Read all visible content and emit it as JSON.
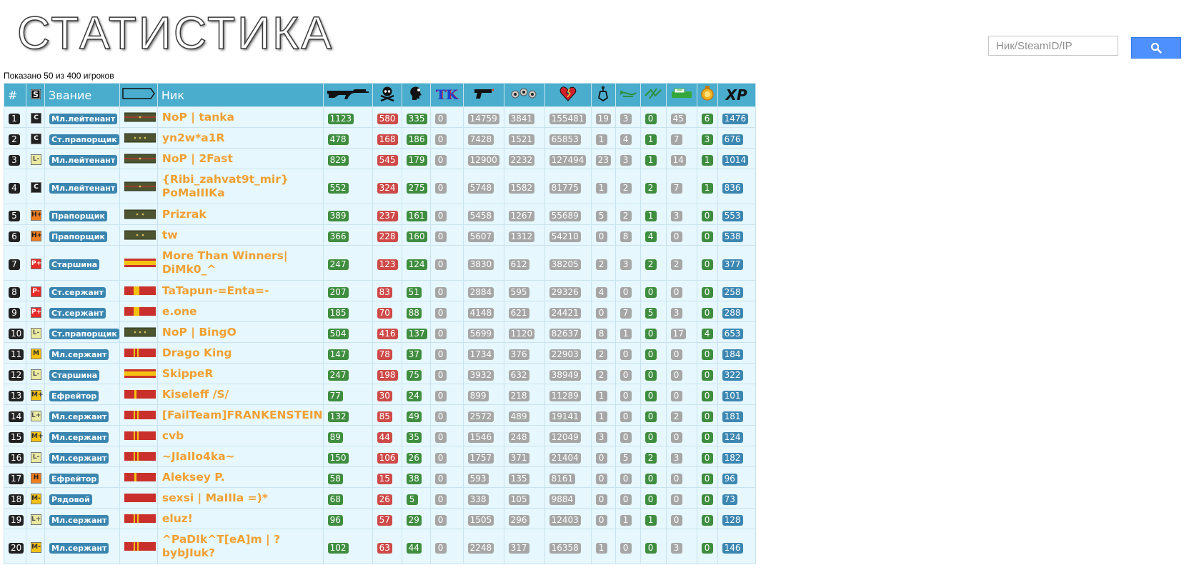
{
  "page": {
    "title": "СТАТИСТИКА",
    "shown_info": "Показано 50 из 400 игроков"
  },
  "search": {
    "placeholder": "Ник/SteamID/IP",
    "value": "",
    "button_icon": "search-icon"
  },
  "table": {
    "headers": {
      "num": "#",
      "skill_icon": "skill-s-icon",
      "rank": "Звание",
      "shoulder_icon": "shoulder-strap-icon",
      "nick": "Ник",
      "kills_icon": "rifle-icon",
      "deaths_icon": "skull-crossbones-icon",
      "headshots_icon": "headshot-icon",
      "teamkills": "TK",
      "shots_icon": "pistol-icon",
      "hits_icon": "bullet-holes-icon",
      "damage_icon": "broken-heart-icon",
      "suicides_icon": "grenade-icon",
      "bomb_plants_icon": "bomb-plant-icon",
      "bomb_defuses_icon": "bomb-defuse-icon",
      "bomb_explosions_icon": "bomb-explode-icon",
      "wins_icon": "medal-icon",
      "xp": "XP"
    },
    "rows": [
      {
        "num": "1",
        "skill": "C",
        "skill_bg": "#222222",
        "skill_fg": "#ffffff",
        "rank": "Мл.лейтенант",
        "strap": "lt",
        "nick": "NoP | tanka",
        "kills": "1123",
        "deaths": "580",
        "hs": "335",
        "tk": "0",
        "shots": "14759",
        "hits": "3841",
        "dmg": "155481",
        "c1": "19",
        "c2": "3",
        "c3": "0",
        "c4": "45",
        "c5": "6",
        "xp": "1476",
        "tall": false
      },
      {
        "num": "2",
        "skill": "C",
        "skill_bg": "#222222",
        "skill_fg": "#ffffff",
        "rank": "Ст.прапорщик",
        "strap": "praporshik3",
        "nick": "yn2w*a1R",
        "kills": "478",
        "deaths": "168",
        "hs": "186",
        "tk": "0",
        "shots": "7428",
        "hits": "1521",
        "dmg": "65853",
        "c1": "1",
        "c2": "4",
        "c3": "1",
        "c4": "7",
        "c5": "3",
        "xp": "676",
        "tall": false
      },
      {
        "num": "3",
        "skill": "L-",
        "skill_bg": "#eaeaa0",
        "skill_fg": "#555555",
        "rank": "Мл.лейтенант",
        "strap": "lt",
        "nick": "NoP | 2Fast",
        "kills": "829",
        "deaths": "545",
        "hs": "179",
        "tk": "0",
        "shots": "12900",
        "hits": "2232",
        "dmg": "127494",
        "c1": "23",
        "c2": "3",
        "c3": "1",
        "c4": "14",
        "c5": "1",
        "xp": "1014",
        "tall": false
      },
      {
        "num": "4",
        "skill": "C",
        "skill_bg": "#222222",
        "skill_fg": "#ffffff",
        "rank": "Мл.лейтенант",
        "strap": "lt",
        "nick": "{Ribi_zahvat9t_mir} PoMaIIIKa",
        "kills": "552",
        "deaths": "324",
        "hs": "275",
        "tk": "0",
        "shots": "5748",
        "hits": "1582",
        "dmg": "81775",
        "c1": "1",
        "c2": "2",
        "c3": "2",
        "c4": "7",
        "c5": "1",
        "xp": "836",
        "tall": true
      },
      {
        "num": "5",
        "skill": "H+",
        "skill_bg": "#f07d1e",
        "skill_fg": "#222222",
        "rank": "Прапорщик",
        "strap": "praporshik2",
        "nick": "Prizrak",
        "kills": "389",
        "deaths": "237",
        "hs": "161",
        "tk": "0",
        "shots": "5458",
        "hits": "1267",
        "dmg": "55689",
        "c1": "5",
        "c2": "2",
        "c3": "1",
        "c4": "3",
        "c5": "0",
        "xp": "553",
        "tall": false
      },
      {
        "num": "6",
        "skill": "H+",
        "skill_bg": "#f07d1e",
        "skill_fg": "#222222",
        "rank": "Прапорщик",
        "strap": "praporshik2",
        "nick": "tw",
        "kills": "366",
        "deaths": "228",
        "hs": "160",
        "tk": "0",
        "shots": "5607",
        "hits": "1312",
        "dmg": "54210",
        "c1": "0",
        "c2": "8",
        "c3": "4",
        "c4": "0",
        "c5": "0",
        "xp": "538",
        "tall": false
      },
      {
        "num": "7",
        "skill": "P+",
        "skill_bg": "#e82a28",
        "skill_fg": "#ffffff",
        "rank": "Старшина",
        "strap": "starshina",
        "nick": "More Than Winners| DiMk0_^",
        "kills": "247",
        "deaths": "123",
        "hs": "124",
        "tk": "0",
        "shots": "3830",
        "hits": "612",
        "dmg": "38205",
        "c1": "2",
        "c2": "3",
        "c3": "2",
        "c4": "2",
        "c5": "0",
        "xp": "377",
        "tall": true
      },
      {
        "num": "8",
        "skill": "P-",
        "skill_bg": "#e82a28",
        "skill_fg": "#ffffff",
        "rank": "Ст.сержант",
        "strap": "st_serzhant",
        "nick": "TaTapun-=Enta=-",
        "kills": "207",
        "deaths": "83",
        "hs": "51",
        "tk": "0",
        "shots": "2884",
        "hits": "595",
        "dmg": "29326",
        "c1": "4",
        "c2": "0",
        "c3": "0",
        "c4": "0",
        "c5": "0",
        "xp": "258",
        "tall": false
      },
      {
        "num": "9",
        "skill": "P+",
        "skill_bg": "#e82a28",
        "skill_fg": "#ffffff",
        "rank": "Ст.сержант",
        "strap": "st_serzhant",
        "nick": "e.one",
        "kills": "185",
        "deaths": "70",
        "hs": "88",
        "tk": "0",
        "shots": "4148",
        "hits": "621",
        "dmg": "24421",
        "c1": "0",
        "c2": "7",
        "c3": "5",
        "c4": "3",
        "c5": "0",
        "xp": "288",
        "tall": false
      },
      {
        "num": "10",
        "skill": "L-",
        "skill_bg": "#eaeaa0",
        "skill_fg": "#555555",
        "rank": "Ст.прапорщик",
        "strap": "praporshik3",
        "nick": "NoP | BingO",
        "kills": "504",
        "deaths": "416",
        "hs": "137",
        "tk": "0",
        "shots": "5699",
        "hits": "1120",
        "dmg": "82637",
        "c1": "8",
        "c2": "1",
        "c3": "0",
        "c4": "17",
        "c5": "4",
        "xp": "653",
        "tall": false
      },
      {
        "num": "11",
        "skill": "M",
        "skill_bg": "#f5c211",
        "skill_fg": "#333333",
        "rank": "Мл.сержант",
        "strap": "ml_serzhant",
        "nick": "Drago King",
        "kills": "147",
        "deaths": "78",
        "hs": "37",
        "tk": "0",
        "shots": "1734",
        "hits": "376",
        "dmg": "22903",
        "c1": "2",
        "c2": "0",
        "c3": "0",
        "c4": "0",
        "c5": "0",
        "xp": "184",
        "tall": false
      },
      {
        "num": "12",
        "skill": "L-",
        "skill_bg": "#eaeaa0",
        "skill_fg": "#555555",
        "rank": "Старшина",
        "strap": "starshina",
        "nick": "SkippeR",
        "kills": "247",
        "deaths": "198",
        "hs": "75",
        "tk": "0",
        "shots": "3932",
        "hits": "632",
        "dmg": "38949",
        "c1": "2",
        "c2": "0",
        "c3": "0",
        "c4": "0",
        "c5": "0",
        "xp": "322",
        "tall": false
      },
      {
        "num": "13",
        "skill": "M+",
        "skill_bg": "#f5c211",
        "skill_fg": "#333333",
        "rank": "Ефрейтор",
        "strap": "efreitor",
        "nick": "Kiseleff /S/",
        "kills": "77",
        "deaths": "30",
        "hs": "24",
        "tk": "0",
        "shots": "899",
        "hits": "218",
        "dmg": "11289",
        "c1": "1",
        "c2": "0",
        "c3": "0",
        "c4": "0",
        "c5": "0",
        "xp": "101",
        "tall": false
      },
      {
        "num": "14",
        "skill": "L+",
        "skill_bg": "#eaeaa0",
        "skill_fg": "#555555",
        "rank": "Мл.сержант",
        "strap": "ml_serzhant",
        "nick": "[FailTeam]FRANKENSTEIN",
        "kills": "132",
        "deaths": "85",
        "hs": "49",
        "tk": "0",
        "shots": "2572",
        "hits": "489",
        "dmg": "19141",
        "c1": "1",
        "c2": "0",
        "c3": "0",
        "c4": "2",
        "c5": "0",
        "xp": "181",
        "tall": false
      },
      {
        "num": "15",
        "skill": "M+",
        "skill_bg": "#f5c211",
        "skill_fg": "#333333",
        "rank": "Мл.сержант",
        "strap": "ml_serzhant",
        "nick": "cvb",
        "kills": "89",
        "deaths": "44",
        "hs": "35",
        "tk": "0",
        "shots": "1546",
        "hits": "248",
        "dmg": "12049",
        "c1": "3",
        "c2": "0",
        "c3": "0",
        "c4": "0",
        "c5": "0",
        "xp": "124",
        "tall": false
      },
      {
        "num": "16",
        "skill": "L-",
        "skill_bg": "#eaeaa0",
        "skill_fg": "#555555",
        "rank": "Мл.сержант",
        "strap": "ml_serzhant",
        "nick": "~JIaIIo4ka~",
        "kills": "150",
        "deaths": "106",
        "hs": "26",
        "tk": "0",
        "shots": "1757",
        "hits": "371",
        "dmg": "21404",
        "c1": "0",
        "c2": "5",
        "c3": "2",
        "c4": "3",
        "c5": "0",
        "xp": "182",
        "tall": false
      },
      {
        "num": "17",
        "skill": "H",
        "skill_bg": "#f07d1e",
        "skill_fg": "#222222",
        "rank": "Ефрейтор",
        "strap": "efreitor",
        "nick": "Aleksey P.",
        "kills": "58",
        "deaths": "15",
        "hs": "38",
        "tk": "0",
        "shots": "593",
        "hits": "135",
        "dmg": "8161",
        "c1": "0",
        "c2": "0",
        "c3": "0",
        "c4": "0",
        "c5": "0",
        "xp": "96",
        "tall": false
      },
      {
        "num": "18",
        "skill": "M-",
        "skill_bg": "#f5c211",
        "skill_fg": "#333333",
        "rank": "Рядовой",
        "strap": "ryadovoy",
        "nick": "sexsi | MaIIIa =)*",
        "kills": "68",
        "deaths": "26",
        "hs": "5",
        "tk": "0",
        "shots": "338",
        "hits": "105",
        "dmg": "9884",
        "c1": "0",
        "c2": "0",
        "c3": "0",
        "c4": "0",
        "c5": "0",
        "xp": "73",
        "tall": false
      },
      {
        "num": "19",
        "skill": "L+",
        "skill_bg": "#eaeaa0",
        "skill_fg": "#555555",
        "rank": "Мл.сержант",
        "strap": "ml_serzhant",
        "nick": "eluz!",
        "kills": "96",
        "deaths": "57",
        "hs": "29",
        "tk": "0",
        "shots": "1505",
        "hits": "296",
        "dmg": "12403",
        "c1": "0",
        "c2": "1",
        "c3": "1",
        "c4": "0",
        "c5": "0",
        "xp": "128",
        "tall": false
      },
      {
        "num": "20",
        "skill": "M-",
        "skill_bg": "#f5c211",
        "skill_fg": "#333333",
        "rank": "Мл.сержант",
        "strap": "ml_serzhant",
        "nick": "^PaDIk^T[eA]m | ?bybJIuk?",
        "kills": "102",
        "deaths": "63",
        "hs": "44",
        "tk": "0",
        "shots": "2248",
        "hits": "317",
        "dmg": "16358",
        "c1": "1",
        "c2": "0",
        "c3": "0",
        "c4": "3",
        "c5": "0",
        "xp": "146",
        "tall": true
      }
    ]
  },
  "colors": {
    "header_bg": "#4aadcd",
    "row_bg": "#e6f7fd",
    "nick": "#f0a032",
    "rank_label": "#3a86b0",
    "kills": "#3f8d3f",
    "deaths": "#cd4a48",
    "neutral": "#a6a6a6",
    "xp": "#3c87b2",
    "search_button": "#4d90fe"
  }
}
